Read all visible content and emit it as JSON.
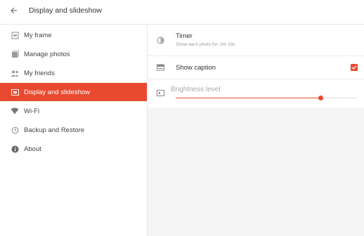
{
  "header": {
    "back_icon": "arrow-left-icon",
    "title": "Display and slideshow"
  },
  "sidebar": {
    "items": [
      {
        "label": "My frame",
        "icon": "frame-icon"
      },
      {
        "label": "Manage photos",
        "icon": "photos-icon"
      },
      {
        "label": "My friends",
        "icon": "friends-icon"
      },
      {
        "label": "Display and slideshow",
        "icon": "display-icon",
        "active": true
      },
      {
        "label": "Wi-Fi",
        "icon": "wifi-icon"
      },
      {
        "label": "Backup and Restore",
        "icon": "backup-icon"
      },
      {
        "label": "About",
        "icon": "info-icon"
      }
    ]
  },
  "settings": {
    "timer": {
      "title": "Timer",
      "subtitle": "Show each photo for: 0m 10s",
      "icon": "timer-icon"
    },
    "caption": {
      "label": "Show caption",
      "checked": true,
      "icon": "caption-icon"
    },
    "brightness": {
      "label": "Brightness level",
      "value": 0.8,
      "icon": "brightness-icon"
    }
  },
  "colors": {
    "accent": "#e84a2f",
    "active_text": "#ffffff"
  }
}
